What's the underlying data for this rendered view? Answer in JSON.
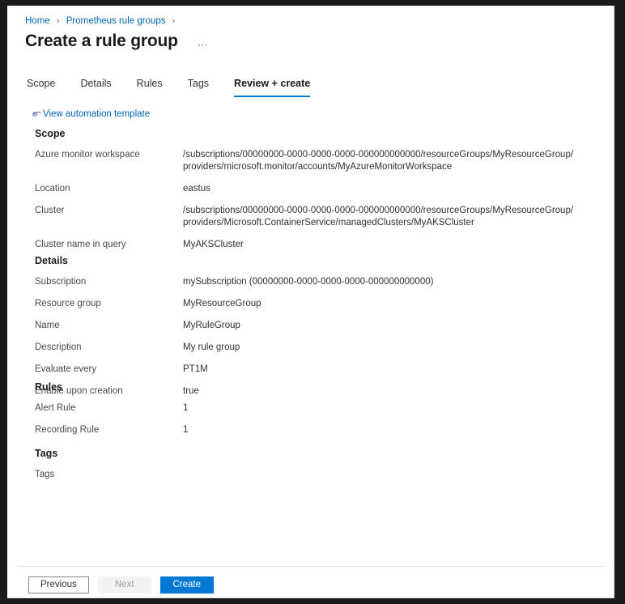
{
  "breadcrumb": {
    "items": [
      {
        "label": "Home"
      },
      {
        "label": "Prometheus rule groups"
      }
    ],
    "separator": "›"
  },
  "header": {
    "title": "Create a rule group",
    "ellipsis": "⋯"
  },
  "tabs": [
    {
      "label": "Scope",
      "selected": false
    },
    {
      "label": "Details",
      "selected": false
    },
    {
      "label": "Rules",
      "selected": false
    },
    {
      "label": "Tags",
      "selected": false
    },
    {
      "label": "Review + create",
      "selected": true
    }
  ],
  "automation": {
    "label": "View automation template",
    "icon": "view-template-icon"
  },
  "sections": {
    "scope": {
      "heading": "Scope",
      "rows": [
        {
          "key": "Azure monitor workspace",
          "value": "/subscriptions/00000000-0000-0000-0000-000000000000/resourceGroups/MyResourceGroup/providers/microsoft.monitor/accounts/MyAzureMonitorWorkspace"
        },
        {
          "key": "Location",
          "value": "eastus"
        },
        {
          "key": "Cluster",
          "value": "/subscriptions/00000000-0000-0000-0000-000000000000/resourceGroups/MyResourceGroup/providers/Microsoft.ContainerService/managedClusters/MyAKSCluster"
        },
        {
          "key": "Cluster name in query",
          "value": "MyAKSCluster"
        }
      ]
    },
    "details": {
      "heading": "Details",
      "rows": [
        {
          "key": "Subscription",
          "value": "mySubscription (00000000-0000-0000-0000-000000000000)"
        },
        {
          "key": "Resource group",
          "value": "MyResourceGroup"
        },
        {
          "key": "Name",
          "value": "MyRuleGroup"
        },
        {
          "key": "Description",
          "value": "My rule group"
        },
        {
          "key": "Evaluate every",
          "value": "PT1M"
        },
        {
          "key": "Enable upon creation",
          "value": "true"
        }
      ]
    },
    "rules": {
      "heading": "Rules",
      "rows": [
        {
          "key": "Alert Rule",
          "value": "1"
        },
        {
          "key": "Recording Rule",
          "value": "1"
        }
      ]
    },
    "tags": {
      "heading": "Tags",
      "rows": [
        {
          "key": "Tags",
          "value": ""
        }
      ]
    }
  },
  "footer": {
    "previous_label": "Previous",
    "next_label": "Next",
    "create_label": "Create"
  },
  "colors": {
    "accent": "#0078d4",
    "link": "#0066b4",
    "text": "#323130",
    "muted": "#4a4a4a"
  }
}
